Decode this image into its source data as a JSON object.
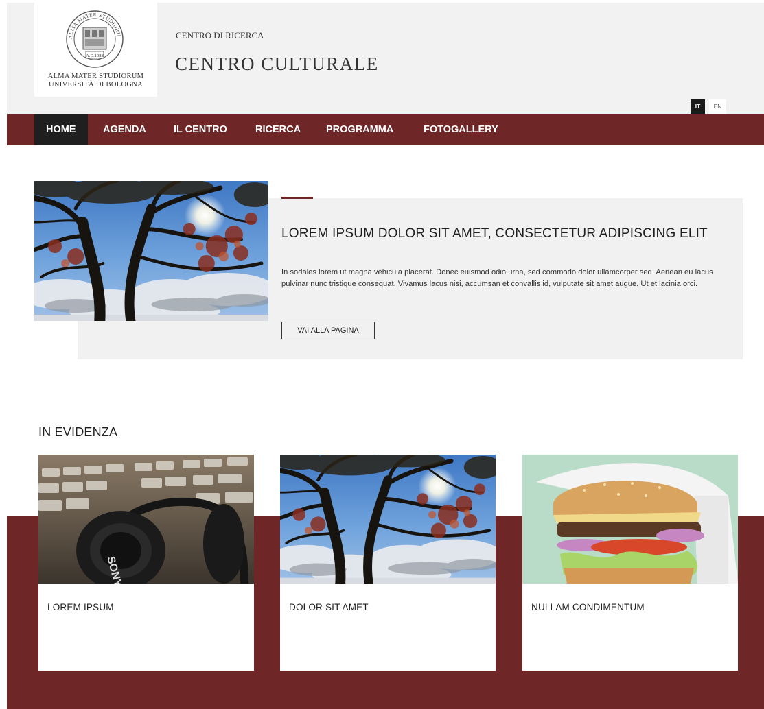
{
  "header": {
    "logo": {
      "line1": "ALMA MATER STUDIORUM",
      "line2": "UNIVERSITÀ DI BOLOGNA",
      "seal_text": "ALMA MATER STUDIORUM",
      "seal_year": "A.D.1088"
    },
    "subtitle": "CENTRO DI RICERCA",
    "title": "CENTRO CULTURALE",
    "languages": [
      {
        "code": "IT",
        "active": true
      },
      {
        "code": "EN",
        "active": false
      }
    ]
  },
  "nav": {
    "items": [
      {
        "label": "HOME",
        "active": true
      },
      {
        "label": "AGENDA",
        "active": false
      },
      {
        "label": "IL CENTRO",
        "active": false
      },
      {
        "label": "RICERCA",
        "active": false
      },
      {
        "label": "PROGRAMMA",
        "active": false
      },
      {
        "label": "FOTOGALLERY",
        "active": false
      }
    ]
  },
  "hero": {
    "image_icon": "tree-sky-photo",
    "title": "LOREM IPSUM DOLOR SIT AMET, CONSECTETUR ADIPISCING ELIT",
    "text": "In sodales lorem ut magna vehicula placerat. Donec euismod odio urna, sed commodo dolor ullamcorper sed. Aenean eu lacus pulvinar nunc tristique consequat. Vivamus lacus nisi, accumsan et convallis id, vulputate sit amet augue. Ut et lacinia orci.",
    "button_label": "VAI ALLA PAGINA"
  },
  "featured": {
    "heading": "IN EVIDENZA",
    "cards": [
      {
        "title": "LOREM IPSUM",
        "image_icon": "headphones-keyboard-photo",
        "brand_text": "SONY"
      },
      {
        "title": "DOLOR SIT AMET",
        "image_icon": "tree-sky-photo"
      },
      {
        "title": "NULLAM CONDIMENTUM",
        "image_icon": "burger-photo"
      }
    ]
  },
  "colors": {
    "brand": "#6e2627",
    "nav_active": "#1f1f1f",
    "header_bg": "#f2f2f2",
    "panel_bg": "#f1f1f1"
  }
}
